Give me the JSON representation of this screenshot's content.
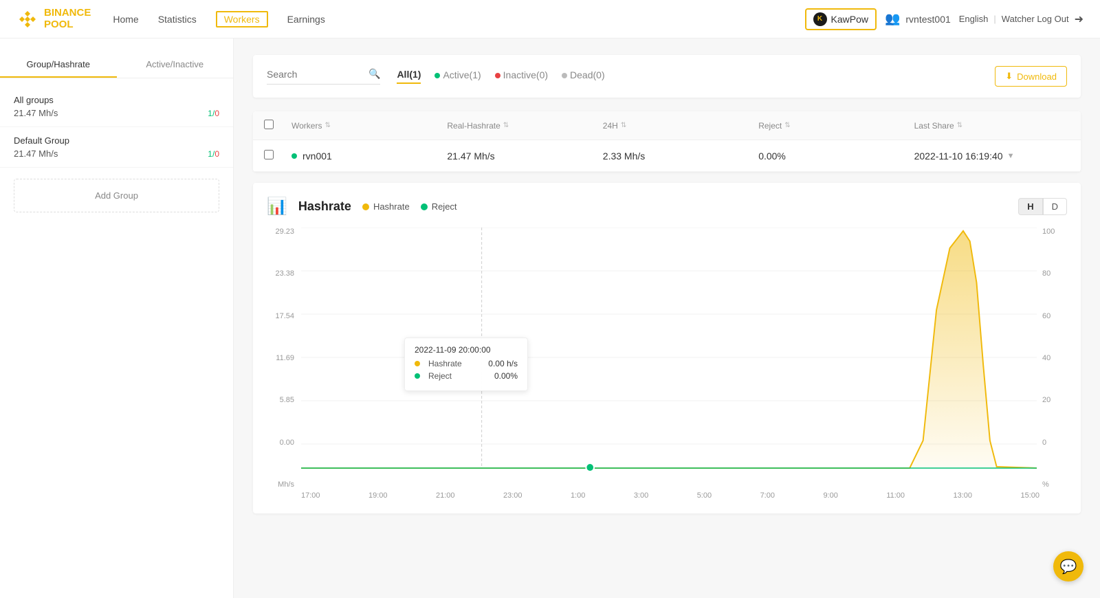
{
  "header": {
    "logo_line1": "BINANCE",
    "logo_line2": "POOL",
    "nav": [
      {
        "label": "Home",
        "key": "home",
        "active": false
      },
      {
        "label": "Statistics",
        "key": "statistics",
        "active": false
      },
      {
        "label": "Workers",
        "key": "workers",
        "active": true
      },
      {
        "label": "Earnings",
        "key": "earnings",
        "active": false
      }
    ],
    "coin_selector_label": "KawPow",
    "user_icon_label": "👥",
    "username": "rvntest001",
    "language": "English",
    "logout_label": "Watcher Log Out"
  },
  "sidebar": {
    "tab1": "Group/Hashrate",
    "tab2": "Active/Inactive",
    "groups": [
      {
        "name": "All groups",
        "hashrate": "21.47 Mh/s",
        "active": "1",
        "inactive": "0"
      },
      {
        "name": "Default Group",
        "hashrate": "21.47 Mh/s",
        "active": "1",
        "inactive": "0"
      }
    ],
    "add_group_label": "Add Group"
  },
  "filters": {
    "search_placeholder": "Search",
    "tabs": [
      {
        "label": "All(1)",
        "key": "all",
        "active": true,
        "dot": null
      },
      {
        "label": "Active(1)",
        "key": "active",
        "active": false,
        "dot": "green"
      },
      {
        "label": "Inactive(0)",
        "key": "inactive",
        "active": false,
        "dot": "red"
      },
      {
        "label": "Dead(0)",
        "key": "dead",
        "active": false,
        "dot": "gray"
      }
    ],
    "download_label": "Download"
  },
  "table": {
    "columns": [
      "Workers",
      "Real-Hashrate",
      "24H",
      "Reject",
      "Last Share"
    ],
    "rows": [
      {
        "name": "rvn001",
        "real_hashrate": "21.47 Mh/s",
        "h24": "2.33 Mh/s",
        "reject": "0.00%",
        "last_share": "2022-11-10 16:19:40",
        "status": "active"
      }
    ]
  },
  "chart": {
    "title": "Hashrate",
    "icon": "📊",
    "legend": [
      {
        "label": "Hashrate",
        "color": "yellow"
      },
      {
        "label": "Reject",
        "color": "green"
      }
    ],
    "period_h": "H",
    "period_d": "D",
    "y_unit_left": "Mh/s",
    "y_unit_right": "%",
    "y_labels_left": [
      "29.23",
      "23.38",
      "17.54",
      "11.69",
      "5.85",
      "0.00"
    ],
    "y_labels_right": [
      "100",
      "80",
      "60",
      "40",
      "20",
      "0"
    ],
    "x_labels": [
      "17:00",
      "19:00",
      "21:00",
      "23:00",
      "1:00",
      "3:00",
      "5:00",
      "7:00",
      "9:00",
      "11:00",
      "13:00",
      "15:00"
    ],
    "tooltip": {
      "date": "2022-11-09 20:00:00",
      "hashrate_label": "Hashrate",
      "hashrate_value": "0.00 h/s",
      "reject_label": "Reject",
      "reject_value": "0.00%"
    }
  },
  "chat_icon": "💬"
}
